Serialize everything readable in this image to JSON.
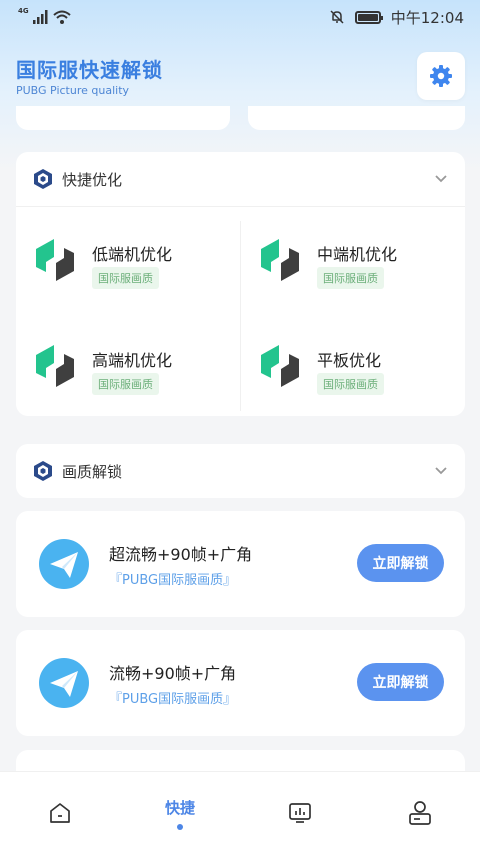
{
  "status_bar": {
    "network": "4G",
    "time": "中午12:04",
    "icons": [
      "signal-icon",
      "wifi-icon",
      "bell-off-icon",
      "battery-icon"
    ]
  },
  "header": {
    "title": "国际服快速解锁",
    "subtitle": "PUBG Picture quality",
    "settings_icon": "gear-icon"
  },
  "quick_section": {
    "title": "快捷优化",
    "options": [
      {
        "name": "低端机优化",
        "tag": "国际服画质"
      },
      {
        "name": "中端机优化",
        "tag": "国际服画质"
      },
      {
        "name": "高端机优化",
        "tag": "国际服画质"
      },
      {
        "name": "平板优化",
        "tag": "国际服画质"
      }
    ]
  },
  "quality_section": {
    "title": "画质解锁"
  },
  "unlock_items": [
    {
      "title": "超流畅+90帧+广角",
      "subtitle": "『PUBG国际服画质』",
      "button": "立即解锁"
    },
    {
      "title": "流畅+90帧+广角",
      "subtitle": "『PUBG国际服画质』",
      "button": "立即解锁"
    }
  ],
  "bottom_nav": {
    "items": [
      {
        "icon": "home-icon",
        "label": ""
      },
      {
        "icon": "",
        "label": "快捷",
        "active": true
      },
      {
        "icon": "chart-monitor-icon",
        "label": ""
      },
      {
        "icon": "profile-icon",
        "label": ""
      }
    ]
  },
  "colors": {
    "accent": "#4d86e6",
    "button": "#5b93ef",
    "tag_text": "#6caf7a",
    "tag_bg": "#eaf6ec"
  }
}
